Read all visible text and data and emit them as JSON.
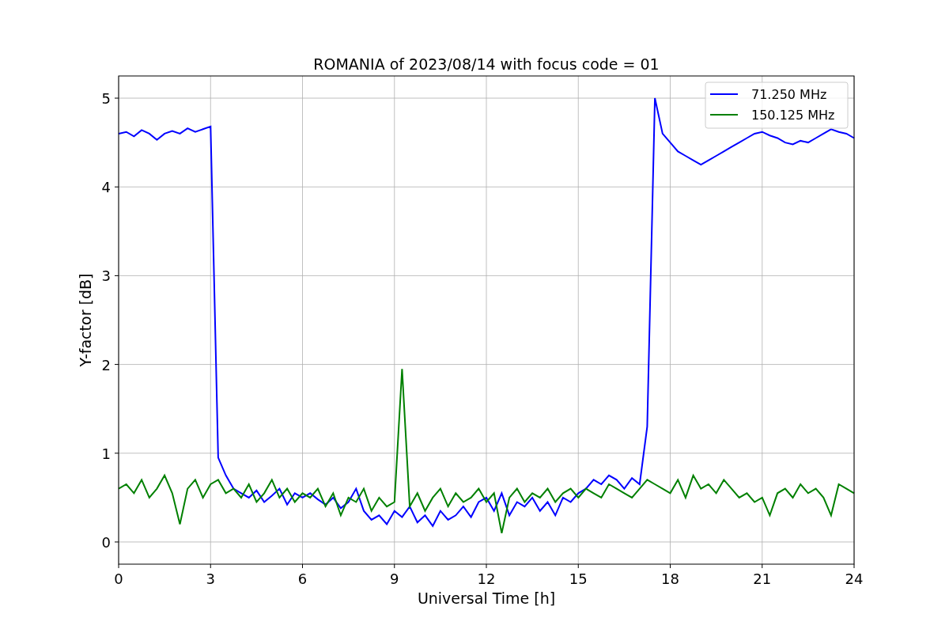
{
  "chart_data": {
    "type": "line",
    "title": "ROMANIA of 2023/08/14 with focus code = 01",
    "xlabel": "Universal Time [h]",
    "ylabel": "Y-factor [dB]",
    "x": [
      0,
      0.25,
      0.5,
      0.75,
      1,
      1.25,
      1.5,
      1.75,
      2,
      2.25,
      2.5,
      2.75,
      3,
      3.25,
      3.5,
      3.75,
      4,
      4.25,
      4.5,
      4.75,
      5,
      5.25,
      5.5,
      5.75,
      6,
      6.25,
      6.5,
      6.75,
      7,
      7.25,
      7.5,
      7.75,
      8,
      8.25,
      8.5,
      8.75,
      9,
      9.25,
      9.5,
      9.75,
      10,
      10.25,
      10.5,
      10.75,
      11,
      11.25,
      11.5,
      11.75,
      12,
      12.25,
      12.5,
      12.75,
      13,
      13.25,
      13.5,
      13.75,
      14,
      14.25,
      14.5,
      14.75,
      15,
      15.25,
      15.5,
      15.75,
      16,
      16.25,
      16.5,
      16.75,
      17,
      17.25,
      17.5,
      17.75,
      18,
      18.25,
      18.5,
      18.75,
      19,
      19.25,
      19.5,
      19.75,
      20,
      20.25,
      20.5,
      20.75,
      21,
      21.25,
      21.5,
      21.75,
      22,
      22.25,
      22.5,
      22.75,
      23,
      23.25,
      23.5,
      23.75,
      24
    ],
    "series": [
      {
        "name": "71.250 MHz",
        "color": "#0000ff",
        "values": [
          4.6,
          4.62,
          4.57,
          4.64,
          4.6,
          4.53,
          4.6,
          4.63,
          4.6,
          4.66,
          4.62,
          4.65,
          4.68,
          0.95,
          0.75,
          0.6,
          0.55,
          0.5,
          0.58,
          0.45,
          0.52,
          0.6,
          0.42,
          0.55,
          0.5,
          0.55,
          0.48,
          0.42,
          0.5,
          0.38,
          0.45,
          0.6,
          0.35,
          0.25,
          0.3,
          0.2,
          0.35,
          0.28,
          0.4,
          0.22,
          0.3,
          0.18,
          0.35,
          0.25,
          0.3,
          0.4,
          0.28,
          0.45,
          0.5,
          0.35,
          0.55,
          0.3,
          0.45,
          0.4,
          0.5,
          0.35,
          0.45,
          0.3,
          0.5,
          0.45,
          0.55,
          0.6,
          0.7,
          0.65,
          0.75,
          0.7,
          0.6,
          0.72,
          0.65,
          1.3,
          5.0,
          4.6,
          4.5,
          4.4,
          4.35,
          4.3,
          4.25,
          4.3,
          4.35,
          4.4,
          4.45,
          4.5,
          4.55,
          4.6,
          4.62,
          4.58,
          4.55,
          4.5,
          4.48,
          4.52,
          4.5,
          4.55,
          4.6,
          4.65,
          4.62,
          4.6,
          4.55
        ]
      },
      {
        "name": "150.125 MHz",
        "color": "#008000",
        "values": [
          0.6,
          0.65,
          0.55,
          0.7,
          0.5,
          0.6,
          0.75,
          0.55,
          0.2,
          0.6,
          0.7,
          0.5,
          0.65,
          0.7,
          0.55,
          0.6,
          0.5,
          0.65,
          0.45,
          0.55,
          0.7,
          0.5,
          0.6,
          0.45,
          0.55,
          0.5,
          0.6,
          0.4,
          0.55,
          0.3,
          0.5,
          0.45,
          0.6,
          0.35,
          0.5,
          0.4,
          0.45,
          1.95,
          0.4,
          0.55,
          0.35,
          0.5,
          0.6,
          0.4,
          0.55,
          0.45,
          0.5,
          0.6,
          0.45,
          0.55,
          0.1,
          0.5,
          0.6,
          0.45,
          0.55,
          0.5,
          0.6,
          0.45,
          0.55,
          0.6,
          0.5,
          0.6,
          0.55,
          0.5,
          0.65,
          0.6,
          0.55,
          0.5,
          0.6,
          0.7,
          0.65,
          0.6,
          0.55,
          0.7,
          0.5,
          0.75,
          0.6,
          0.65,
          0.55,
          0.7,
          0.6,
          0.5,
          0.55,
          0.45,
          0.5,
          0.3,
          0.55,
          0.6,
          0.5,
          0.65,
          0.55,
          0.6,
          0.5,
          0.3,
          0.65,
          0.6,
          0.55
        ]
      }
    ],
    "xlim": [
      0,
      24
    ],
    "ylim": [
      -0.25,
      5.25
    ],
    "xticks": [
      0,
      3,
      6,
      9,
      12,
      15,
      18,
      21,
      24
    ],
    "yticks": [
      0,
      1,
      2,
      3,
      4,
      5
    ],
    "grid": true,
    "legend": true
  }
}
